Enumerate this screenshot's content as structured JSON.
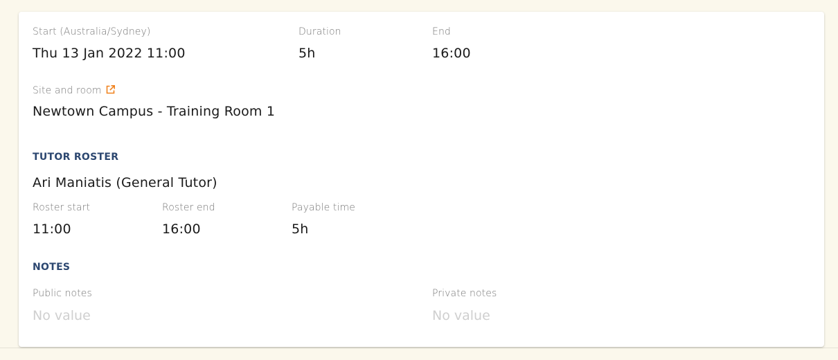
{
  "session": {
    "start_label": "Start (Australia/Sydney)",
    "start_value": "Thu 13 Jan 2022 11:00",
    "duration_label": "Duration",
    "duration_value": "5h",
    "end_label": "End",
    "end_value": "16:00",
    "site_label": "Site and room",
    "site_value": "Newtown Campus - Training Room 1",
    "site_link_icon": "external-link-icon"
  },
  "tutor_roster": {
    "heading": "TUTOR ROSTER",
    "tutor_name": "Ari Maniatis (General Tutor)",
    "roster_start_label": "Roster start",
    "roster_start_value": "11:00",
    "roster_end_label": "Roster end",
    "roster_end_value": "16:00",
    "payable_label": "Payable time",
    "payable_value": "5h"
  },
  "notes": {
    "heading": "NOTES",
    "public_label": "Public notes",
    "public_value": "No value",
    "private_label": "Private notes",
    "private_value": "No value"
  },
  "colors": {
    "page_background": "#fbf8ec",
    "section_heading": "#2c4770",
    "link_icon": "#f0821e"
  }
}
